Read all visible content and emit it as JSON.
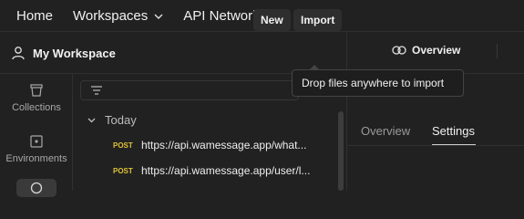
{
  "topnav": {
    "home": "Home",
    "workspaces": "Workspaces",
    "api_network": "API Network"
  },
  "workspace": {
    "title": "My Workspace",
    "new_label": "New",
    "import_label": "Import"
  },
  "tooltip": "Drop files anywhere to import",
  "rail": {
    "collections": "Collections",
    "environments": "Environments"
  },
  "tree": {
    "group": "Today",
    "requests": [
      {
        "method": "POST",
        "url": "https://api.wamessage.app/what..."
      },
      {
        "method": "POST",
        "url": "https://api.wamessage.app/user/l..."
      }
    ]
  },
  "right": {
    "overview_tab": "Overview",
    "subtabs": [
      "Overview",
      "Settings"
    ],
    "active_subtab": "Settings"
  },
  "colors": {
    "bg": "#212121",
    "method_post": "#e0c33a",
    "button": "#2e2e2e"
  }
}
